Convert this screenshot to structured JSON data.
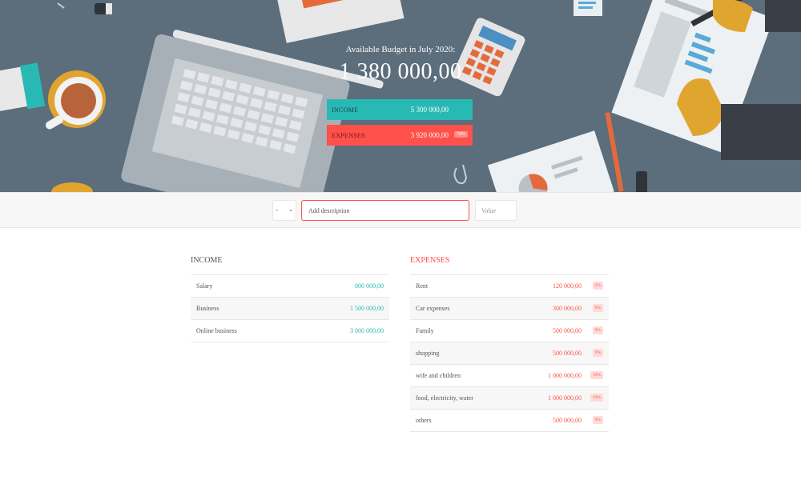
{
  "header": {
    "title": "Available Budget in July 2020:",
    "budget": "1 380 000,00",
    "income": {
      "label": "INCOME",
      "value": "5 300 000,00"
    },
    "expenses": {
      "label": "EXPENSES",
      "value": "3 920 000,00",
      "percent": "74%"
    }
  },
  "add_bar": {
    "type_value": "-",
    "description_placeholder": "Add description",
    "value_placeholder": "Value"
  },
  "income": {
    "title": "INCOME",
    "items": [
      {
        "description": "Salary",
        "value": "800 000,00"
      },
      {
        "description": "Business",
        "value": "1 500 000,00"
      },
      {
        "description": "Online business",
        "value": "3 000 000,00"
      }
    ]
  },
  "expenses": {
    "title": "EXPENSES",
    "items": [
      {
        "description": "Rent",
        "value": "120 000,00",
        "percent": "2%"
      },
      {
        "description": "Car expenses",
        "value": "300 000,00",
        "percent": "6%"
      },
      {
        "description": "Family",
        "value": "500 000,00",
        "percent": "9%"
      },
      {
        "description": "shopping",
        "value": "500 000,00",
        "percent": "9%"
      },
      {
        "description": "wife and children",
        "value": "1 000 000,00",
        "percent": "19%"
      },
      {
        "description": "food, electricity, water",
        "value": "1 000 000,00",
        "percent": "19%"
      },
      {
        "description": "others",
        "value": "500 000,00",
        "percent": "9%"
      }
    ]
  },
  "colors": {
    "hero_bg": "#5c6d7b",
    "income_accent": "#28b9b5",
    "expense_accent": "#ff5049"
  }
}
